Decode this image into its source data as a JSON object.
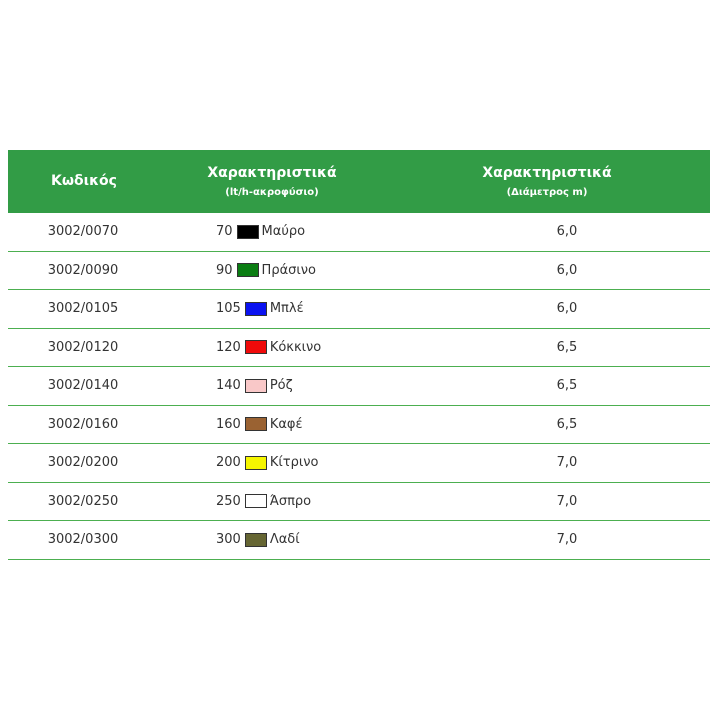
{
  "header": {
    "code": "Κωδικός",
    "features_flow": "Χαρακτηριστικά",
    "features_flow_sub": "(lt/h-ακροφύσιο)",
    "features_diam": "Χαρακτηριστικά",
    "features_diam_sub": "(Διάμετρος m)"
  },
  "rows": [
    {
      "code": "3002/0070",
      "flow": "70",
      "color_name": "Μαύρο",
      "color": "#000000",
      "diameter": "6,0"
    },
    {
      "code": "3002/0090",
      "flow": "90",
      "color_name": "Πράσινο",
      "color": "#0a7d12",
      "diameter": "6,0"
    },
    {
      "code": "3002/0105",
      "flow": "105",
      "color_name": "Μπλέ",
      "color": "#0a12f0",
      "diameter": "6,0"
    },
    {
      "code": "3002/0120",
      "flow": "120",
      "color_name": "Κόκκινο",
      "color": "#f00a0a",
      "diameter": "6,5"
    },
    {
      "code": "3002/0140",
      "flow": "140",
      "color_name": "Ρόζ",
      "color": "#f9c8c8",
      "diameter": "6,5"
    },
    {
      "code": "3002/0160",
      "flow": "160",
      "color_name": "Καφέ",
      "color": "#9a6232",
      "diameter": "6,5"
    },
    {
      "code": "3002/0200",
      "flow": "200",
      "color_name": "Κίτρινο",
      "color": "#f6f600",
      "diameter": "7,0"
    },
    {
      "code": "3002/0250",
      "flow": "250",
      "color_name": "Άσπρο",
      "color": "#ffffff",
      "diameter": "7,0"
    },
    {
      "code": "3002/0300",
      "flow": "300",
      "color_name": "Λαδί",
      "color": "#666633",
      "diameter": "7,0"
    }
  ]
}
